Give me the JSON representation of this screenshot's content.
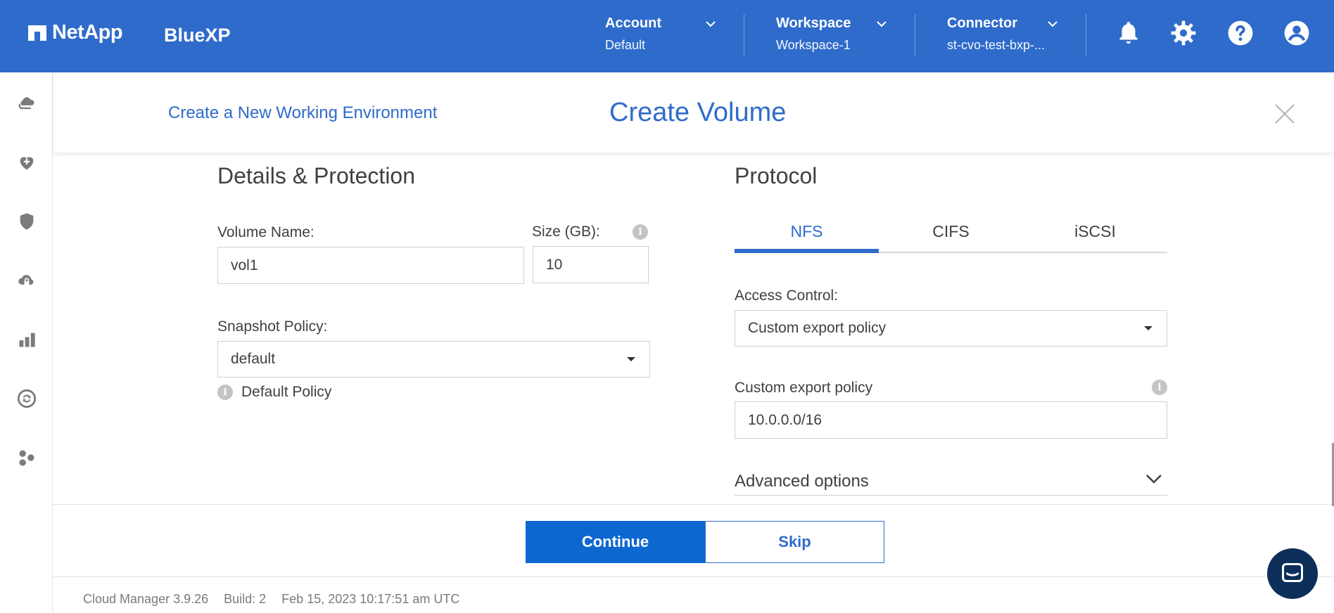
{
  "header": {
    "brand": "NetApp",
    "product": "BlueXP",
    "account": {
      "title": "Account",
      "value": "Default"
    },
    "workspace": {
      "title": "Workspace",
      "value": "Workspace-1"
    },
    "connector": {
      "title": "Connector",
      "value": "st-cvo-test-bxp-..."
    },
    "icons": [
      "bell-icon",
      "gear-icon",
      "help-icon",
      "user-icon"
    ]
  },
  "rail": {
    "icons": [
      "cloud-storage-icon",
      "health-icon",
      "protection-icon",
      "cloud-backup-icon",
      "analytics-icon",
      "sync-icon",
      "integrations-icon"
    ]
  },
  "subheader": {
    "link": "Create a New Working Environment",
    "title": "Create Volume"
  },
  "details": {
    "title": "Details & Protection",
    "volume_name_label": "Volume Name:",
    "volume_name_value": "vol1",
    "size_label": "Size (GB):",
    "size_value": "10",
    "snapshot_label": "Snapshot Policy:",
    "snapshot_value": "default",
    "snapshot_hint": "Default Policy"
  },
  "protocol": {
    "title": "Protocol",
    "tabs": [
      "NFS",
      "CIFS",
      "iSCSI"
    ],
    "active_tab": "NFS",
    "access_control_label": "Access Control:",
    "access_control_value": "Custom export policy",
    "export_policy_label": "Custom export policy",
    "export_policy_value": "10.0.0.0/16",
    "advanced_label": "Advanced options"
  },
  "actions": {
    "continue_label": "Continue",
    "skip_label": "Skip"
  },
  "status": {
    "version": "Cloud Manager 3.9.26",
    "build": "Build: 2",
    "timestamp": "Feb 15, 2023 10:17:51 am UTC"
  },
  "colors": {
    "brand_blue": "#2f6bcb",
    "primary_button": "#0d67d1",
    "chat_bubble": "#0c2f5a"
  }
}
